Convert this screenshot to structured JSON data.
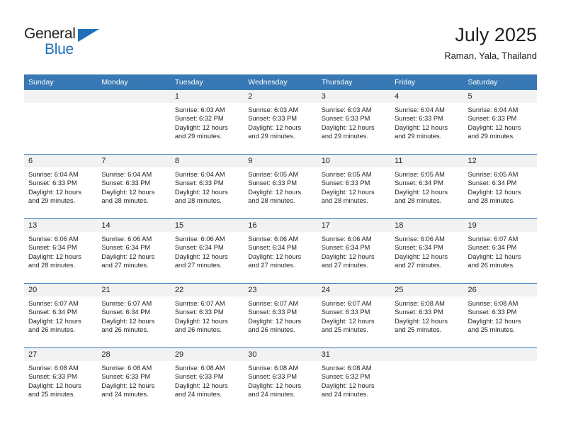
{
  "logo": {
    "word_top": "General",
    "word_bottom": "Blue",
    "triangle_color": "#1c71b8",
    "text_color": "#231f20"
  },
  "header": {
    "title": "July 2025",
    "subtitle": "Raman, Yala, Thailand"
  },
  "theme": {
    "header_bg": "#3878b4",
    "header_text": "#ffffff",
    "daynum_bg": "#f2f2f2",
    "body_text": "#231f20",
    "rule_color": "#3878b4"
  },
  "weekday_headers": [
    "Sunday",
    "Monday",
    "Tuesday",
    "Wednesday",
    "Thursday",
    "Friday",
    "Saturday"
  ],
  "weeks": [
    [
      {
        "day": "",
        "blank": true,
        "sunrise": "",
        "sunset": "",
        "daylight_1": "",
        "daylight_2": ""
      },
      {
        "day": "",
        "blank": true,
        "sunrise": "",
        "sunset": "",
        "daylight_1": "",
        "daylight_2": ""
      },
      {
        "day": "1",
        "sunrise": "Sunrise: 6:03 AM",
        "sunset": "Sunset: 6:32 PM",
        "daylight_1": "Daylight: 12 hours",
        "daylight_2": "and 29 minutes."
      },
      {
        "day": "2",
        "sunrise": "Sunrise: 6:03 AM",
        "sunset": "Sunset: 6:33 PM",
        "daylight_1": "Daylight: 12 hours",
        "daylight_2": "and 29 minutes."
      },
      {
        "day": "3",
        "sunrise": "Sunrise: 6:03 AM",
        "sunset": "Sunset: 6:33 PM",
        "daylight_1": "Daylight: 12 hours",
        "daylight_2": "and 29 minutes."
      },
      {
        "day": "4",
        "sunrise": "Sunrise: 6:04 AM",
        "sunset": "Sunset: 6:33 PM",
        "daylight_1": "Daylight: 12 hours",
        "daylight_2": "and 29 minutes."
      },
      {
        "day": "5",
        "sunrise": "Sunrise: 6:04 AM",
        "sunset": "Sunset: 6:33 PM",
        "daylight_1": "Daylight: 12 hours",
        "daylight_2": "and 29 minutes."
      }
    ],
    [
      {
        "day": "6",
        "sunrise": "Sunrise: 6:04 AM",
        "sunset": "Sunset: 6:33 PM",
        "daylight_1": "Daylight: 12 hours",
        "daylight_2": "and 29 minutes."
      },
      {
        "day": "7",
        "sunrise": "Sunrise: 6:04 AM",
        "sunset": "Sunset: 6:33 PM",
        "daylight_1": "Daylight: 12 hours",
        "daylight_2": "and 28 minutes."
      },
      {
        "day": "8",
        "sunrise": "Sunrise: 6:04 AM",
        "sunset": "Sunset: 6:33 PM",
        "daylight_1": "Daylight: 12 hours",
        "daylight_2": "and 28 minutes."
      },
      {
        "day": "9",
        "sunrise": "Sunrise: 6:05 AM",
        "sunset": "Sunset: 6:33 PM",
        "daylight_1": "Daylight: 12 hours",
        "daylight_2": "and 28 minutes."
      },
      {
        "day": "10",
        "sunrise": "Sunrise: 6:05 AM",
        "sunset": "Sunset: 6:33 PM",
        "daylight_1": "Daylight: 12 hours",
        "daylight_2": "and 28 minutes."
      },
      {
        "day": "11",
        "sunrise": "Sunrise: 6:05 AM",
        "sunset": "Sunset: 6:34 PM",
        "daylight_1": "Daylight: 12 hours",
        "daylight_2": "and 28 minutes."
      },
      {
        "day": "12",
        "sunrise": "Sunrise: 6:05 AM",
        "sunset": "Sunset: 6:34 PM",
        "daylight_1": "Daylight: 12 hours",
        "daylight_2": "and 28 minutes."
      }
    ],
    [
      {
        "day": "13",
        "sunrise": "Sunrise: 6:06 AM",
        "sunset": "Sunset: 6:34 PM",
        "daylight_1": "Daylight: 12 hours",
        "daylight_2": "and 28 minutes."
      },
      {
        "day": "14",
        "sunrise": "Sunrise: 6:06 AM",
        "sunset": "Sunset: 6:34 PM",
        "daylight_1": "Daylight: 12 hours",
        "daylight_2": "and 27 minutes."
      },
      {
        "day": "15",
        "sunrise": "Sunrise: 6:06 AM",
        "sunset": "Sunset: 6:34 PM",
        "daylight_1": "Daylight: 12 hours",
        "daylight_2": "and 27 minutes."
      },
      {
        "day": "16",
        "sunrise": "Sunrise: 6:06 AM",
        "sunset": "Sunset: 6:34 PM",
        "daylight_1": "Daylight: 12 hours",
        "daylight_2": "and 27 minutes."
      },
      {
        "day": "17",
        "sunrise": "Sunrise: 6:06 AM",
        "sunset": "Sunset: 6:34 PM",
        "daylight_1": "Daylight: 12 hours",
        "daylight_2": "and 27 minutes."
      },
      {
        "day": "18",
        "sunrise": "Sunrise: 6:06 AM",
        "sunset": "Sunset: 6:34 PM",
        "daylight_1": "Daylight: 12 hours",
        "daylight_2": "and 27 minutes."
      },
      {
        "day": "19",
        "sunrise": "Sunrise: 6:07 AM",
        "sunset": "Sunset: 6:34 PM",
        "daylight_1": "Daylight: 12 hours",
        "daylight_2": "and 26 minutes."
      }
    ],
    [
      {
        "day": "20",
        "sunrise": "Sunrise: 6:07 AM",
        "sunset": "Sunset: 6:34 PM",
        "daylight_1": "Daylight: 12 hours",
        "daylight_2": "and 26 minutes."
      },
      {
        "day": "21",
        "sunrise": "Sunrise: 6:07 AM",
        "sunset": "Sunset: 6:34 PM",
        "daylight_1": "Daylight: 12 hours",
        "daylight_2": "and 26 minutes."
      },
      {
        "day": "22",
        "sunrise": "Sunrise: 6:07 AM",
        "sunset": "Sunset: 6:33 PM",
        "daylight_1": "Daylight: 12 hours",
        "daylight_2": "and 26 minutes."
      },
      {
        "day": "23",
        "sunrise": "Sunrise: 6:07 AM",
        "sunset": "Sunset: 6:33 PM",
        "daylight_1": "Daylight: 12 hours",
        "daylight_2": "and 26 minutes."
      },
      {
        "day": "24",
        "sunrise": "Sunrise: 6:07 AM",
        "sunset": "Sunset: 6:33 PM",
        "daylight_1": "Daylight: 12 hours",
        "daylight_2": "and 25 minutes."
      },
      {
        "day": "25",
        "sunrise": "Sunrise: 6:08 AM",
        "sunset": "Sunset: 6:33 PM",
        "daylight_1": "Daylight: 12 hours",
        "daylight_2": "and 25 minutes."
      },
      {
        "day": "26",
        "sunrise": "Sunrise: 6:08 AM",
        "sunset": "Sunset: 6:33 PM",
        "daylight_1": "Daylight: 12 hours",
        "daylight_2": "and 25 minutes."
      }
    ],
    [
      {
        "day": "27",
        "sunrise": "Sunrise: 6:08 AM",
        "sunset": "Sunset: 6:33 PM",
        "daylight_1": "Daylight: 12 hours",
        "daylight_2": "and 25 minutes."
      },
      {
        "day": "28",
        "sunrise": "Sunrise: 6:08 AM",
        "sunset": "Sunset: 6:33 PM",
        "daylight_1": "Daylight: 12 hours",
        "daylight_2": "and 24 minutes."
      },
      {
        "day": "29",
        "sunrise": "Sunrise: 6:08 AM",
        "sunset": "Sunset: 6:33 PM",
        "daylight_1": "Daylight: 12 hours",
        "daylight_2": "and 24 minutes."
      },
      {
        "day": "30",
        "sunrise": "Sunrise: 6:08 AM",
        "sunset": "Sunset: 6:33 PM",
        "daylight_1": "Daylight: 12 hours",
        "daylight_2": "and 24 minutes."
      },
      {
        "day": "31",
        "sunrise": "Sunrise: 6:08 AM",
        "sunset": "Sunset: 6:32 PM",
        "daylight_1": "Daylight: 12 hours",
        "daylight_2": "and 24 minutes."
      },
      {
        "day": "",
        "blank": true,
        "sunrise": "",
        "sunset": "",
        "daylight_1": "",
        "daylight_2": ""
      },
      {
        "day": "",
        "blank": true,
        "sunrise": "",
        "sunset": "",
        "daylight_1": "",
        "daylight_2": ""
      }
    ]
  ]
}
